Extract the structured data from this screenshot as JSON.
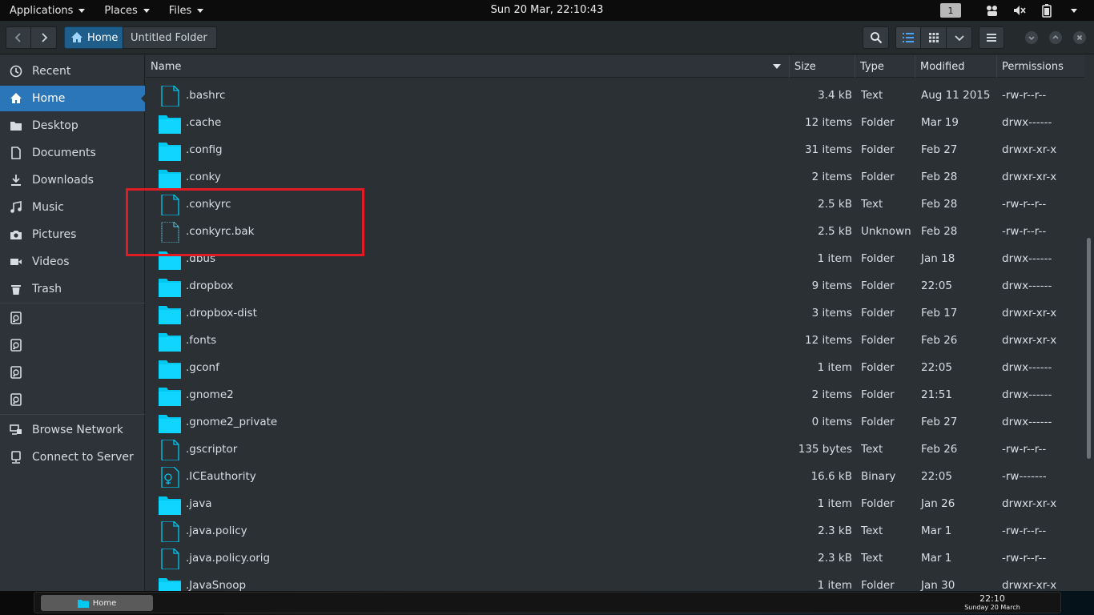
{
  "top_panel": {
    "menus": [
      {
        "label": "Applications"
      },
      {
        "label": "Places"
      },
      {
        "label": "Files"
      }
    ],
    "clock": "Sun 20 Mar, 22:10:43",
    "workspace": "1",
    "tray_icons": [
      "network-icon",
      "volume-icon",
      "battery-icon"
    ]
  },
  "toolbar": {
    "crumbs": [
      "Home",
      "Untitled Folder"
    ]
  },
  "sidebar": {
    "items": [
      {
        "label": "Recent",
        "icon": "clock-icon"
      },
      {
        "label": "Home",
        "icon": "home-icon",
        "active": true
      },
      {
        "label": "Desktop",
        "icon": "folder-icon"
      },
      {
        "label": "Documents",
        "icon": "document-icon"
      },
      {
        "label": "Downloads",
        "icon": "download-icon"
      },
      {
        "label": "Music",
        "icon": "music-icon"
      },
      {
        "label": "Pictures",
        "icon": "camera-icon"
      },
      {
        "label": "Videos",
        "icon": "video-icon"
      },
      {
        "label": "Trash",
        "icon": "trash-icon"
      }
    ],
    "drives_count": 4,
    "network": [
      {
        "label": "Browse Network",
        "icon": "network-icon"
      },
      {
        "label": "Connect to Server",
        "icon": "server-icon"
      }
    ]
  },
  "columns": [
    "Name",
    "Size",
    "Type",
    "Modified",
    "Permissions"
  ],
  "files": [
    {
      "name": ".bashrc",
      "size": "3.4 kB",
      "type": "Text",
      "modified": "Aug 11 2015",
      "perm": "-rw-r--r--",
      "kind": "text"
    },
    {
      "name": ".cache",
      "size": "12 items",
      "type": "Folder",
      "modified": "Mar 19",
      "perm": "drwx------",
      "kind": "folder"
    },
    {
      "name": ".config",
      "size": "31 items",
      "type": "Folder",
      "modified": "Feb 27",
      "perm": "drwxr-xr-x",
      "kind": "folder"
    },
    {
      "name": ".conky",
      "size": "2 items",
      "type": "Folder",
      "modified": "Feb 28",
      "perm": "drwxr-xr-x",
      "kind": "folder"
    },
    {
      "name": ".conkyrc",
      "size": "2.5 kB",
      "type": "Text",
      "modified": "Feb 28",
      "perm": "-rw-r--r--",
      "kind": "text"
    },
    {
      "name": ".conkyrc.bak",
      "size": "2.5 kB",
      "type": "Unknown",
      "modified": "Feb 28",
      "perm": "-rw-r--r--",
      "kind": "unknown"
    },
    {
      "name": ".dbus",
      "size": "1 item",
      "type": "Folder",
      "modified": "Jan 18",
      "perm": "drwx------",
      "kind": "folder"
    },
    {
      "name": ".dropbox",
      "size": "9 items",
      "type": "Folder",
      "modified": "22:05",
      "perm": "drwx------",
      "kind": "folder"
    },
    {
      "name": ".dropbox-dist",
      "size": "3 items",
      "type": "Folder",
      "modified": "Feb 17",
      "perm": "drwxr-xr-x",
      "kind": "folder"
    },
    {
      "name": ".fonts",
      "size": "12 items",
      "type": "Folder",
      "modified": "Feb 26",
      "perm": "drwxr-xr-x",
      "kind": "folder"
    },
    {
      "name": ".gconf",
      "size": "1 item",
      "type": "Folder",
      "modified": "22:05",
      "perm": "drwx------",
      "kind": "folder"
    },
    {
      "name": ".gnome2",
      "size": "2 items",
      "type": "Folder",
      "modified": "21:51",
      "perm": "drwx------",
      "kind": "folder"
    },
    {
      "name": ".gnome2_private",
      "size": "0 items",
      "type": "Folder",
      "modified": "Feb 27",
      "perm": "drwx------",
      "kind": "folder"
    },
    {
      "name": ".gscriptor",
      "size": "135 bytes",
      "type": "Text",
      "modified": "Feb 26",
      "perm": "-rw-r--r--",
      "kind": "text"
    },
    {
      "name": ".ICEauthority",
      "size": "16.6 kB",
      "type": "Binary",
      "modified": "22:05",
      "perm": "-rw-------",
      "kind": "binary"
    },
    {
      "name": ".java",
      "size": "1 item",
      "type": "Folder",
      "modified": "Jan 26",
      "perm": "drwxr-xr-x",
      "kind": "folder"
    },
    {
      "name": ".java.policy",
      "size": "2.3 kB",
      "type": "Text",
      "modified": "Mar 1",
      "perm": "-rw-r--r--",
      "kind": "text"
    },
    {
      "name": ".java.policy.orig",
      "size": "2.3 kB",
      "type": "Text",
      "modified": "Mar 1",
      "perm": "-rw-r--r--",
      "kind": "text"
    },
    {
      "name": ".JavaSnoop",
      "size": "1 item",
      "type": "Folder",
      "modified": "Jan 30",
      "perm": "drwxr-xr-x",
      "kind": "folder"
    }
  ],
  "bottom_panel": {
    "task_label": "Home",
    "clock_time": "22:10",
    "clock_date": "Sunday 20 March"
  },
  "colors": {
    "accent": "#2a76b8",
    "folder": "#00c8f0",
    "highlight": "#e01b24"
  }
}
